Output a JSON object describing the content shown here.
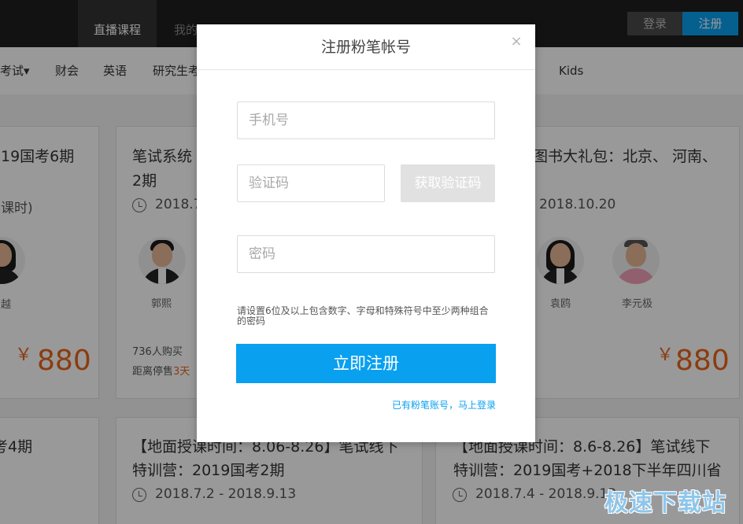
{
  "topnav": {
    "active_tab": "直播课程",
    "second_tab": "我的",
    "login": "登录",
    "register": "注册"
  },
  "categories": [
    "考试▾",
    "财会",
    "英语",
    "研究生考",
    "Kids"
  ],
  "cards": {
    "c1": {
      "title": "19国考6期",
      "sub": "课时)",
      "teacher": "越",
      "price": "880",
      "currency": "￥"
    },
    "c2": {
      "title1": "笔试系统",
      "title2": "2期",
      "date": "2018.7.",
      "teacher": "郭熙",
      "buyers": "736人购买",
      "deadline_prefix": "距离停售",
      "deadline_value": "3天"
    },
    "c3": {
      "title": "图书大礼包：北京、 河南、",
      "date": "2018.10.20",
      "teacher1": "袁鸥",
      "teacher2": "李元极",
      "price": "880",
      "currency": "￥"
    },
    "c4": {
      "title": "考4期"
    },
    "c5": {
      "title1": "【地面授课时间：8.06-8.26】笔试线下",
      "title2": "特训营：2019国考2期",
      "date": "2018.7.2 - 2018.9.13"
    },
    "c6": {
      "title1": "【地面授课时间：8.6-8.26】笔试线下",
      "title2": "特训营：2019国考+2018下半年四川省",
      "date": "2018.7.4 - 2018.9.13"
    }
  },
  "modal": {
    "title": "注册粉笔帐号",
    "close": "×",
    "phone_placeholder": "手机号",
    "code_placeholder": "验证码",
    "get_code": "获取验证码",
    "password_placeholder": "密码",
    "hint": "请设置6位及以上包含数字、字母和特殊符号中至少两种组合的密码",
    "submit": "立即注册",
    "login_link": "已有粉笔账号，马上登录"
  },
  "watermark": "极速下载站",
  "colors": {
    "accent": "#09a0f0",
    "price": "#e8641b",
    "topbar": "#1f1f1f"
  }
}
